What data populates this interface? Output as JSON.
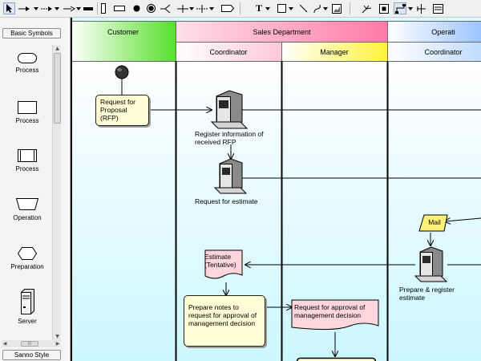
{
  "toolbar": {
    "tools": [
      "select-tool",
      "arrow-connector-tool",
      "dashed-arrow-tool",
      "flow-arrow-tool",
      "long-arrow-tool",
      "thick-line-tool",
      "swimlane-vertical-tool",
      "swimlane-horizontal-tool",
      "initial-node-tool",
      "final-node-tool",
      "fork-tool",
      "horizontal-lane-tool",
      "vertical-lane-tool",
      "note-shape-tool",
      "text-tool",
      "rectangle-tool",
      "line-tool",
      "curve-tool",
      "image-tool",
      "pan-tool",
      "fit-tool",
      "connector-style-tool",
      "resize-tool",
      "layout-tool"
    ],
    "text_tool_glyph": "T"
  },
  "palette": {
    "top_tab": "Basic Symbols",
    "bottom_tab": "Sanno Style",
    "items": [
      {
        "label": "Process",
        "shape": "rounded-rect"
      },
      {
        "label": "Process",
        "shape": "rect"
      },
      {
        "label": "Process",
        "shape": "predefined-process"
      },
      {
        "label": "Operation",
        "shape": "trapezoid"
      },
      {
        "label": "Preparation",
        "shape": "hexagon"
      },
      {
        "label": "Server",
        "shape": "server"
      }
    ],
    "scroll_up": "▲",
    "scroll_down": "▼",
    "scroll_left": "◀",
    "scroll_right": "▶",
    "grip": "|||"
  },
  "canvas": {
    "lanes": {
      "customer": "Customer",
      "sales": "Sales Department",
      "operations": "Operati",
      "coordinator_1": "Coordinator",
      "manager": "Manager",
      "coordinator_2": "Coordinator"
    },
    "nodes": {
      "rfp": "Request for Proposal (RFP)",
      "register_info": "Register information of received RFP",
      "request_estimate": "Request for estimate",
      "mail": "Mail",
      "estimate_doc": "Estimate (Tentative)",
      "prepare_register": "Prepare & register estimate",
      "prepare_notes": "Prepare notes to request for approval of  management decision",
      "approval_doc": "Request  for approval of management decision"
    },
    "colors": {
      "canvas_bg": "#d9fbff",
      "customer_header": "#7ef04a",
      "sales_header": "#ff9bbd",
      "manager_header": "#fff55a",
      "operations_header": "#9ec6ff",
      "box_fill": "#fffed6",
      "doc_fill": "#ffd6dc"
    }
  }
}
